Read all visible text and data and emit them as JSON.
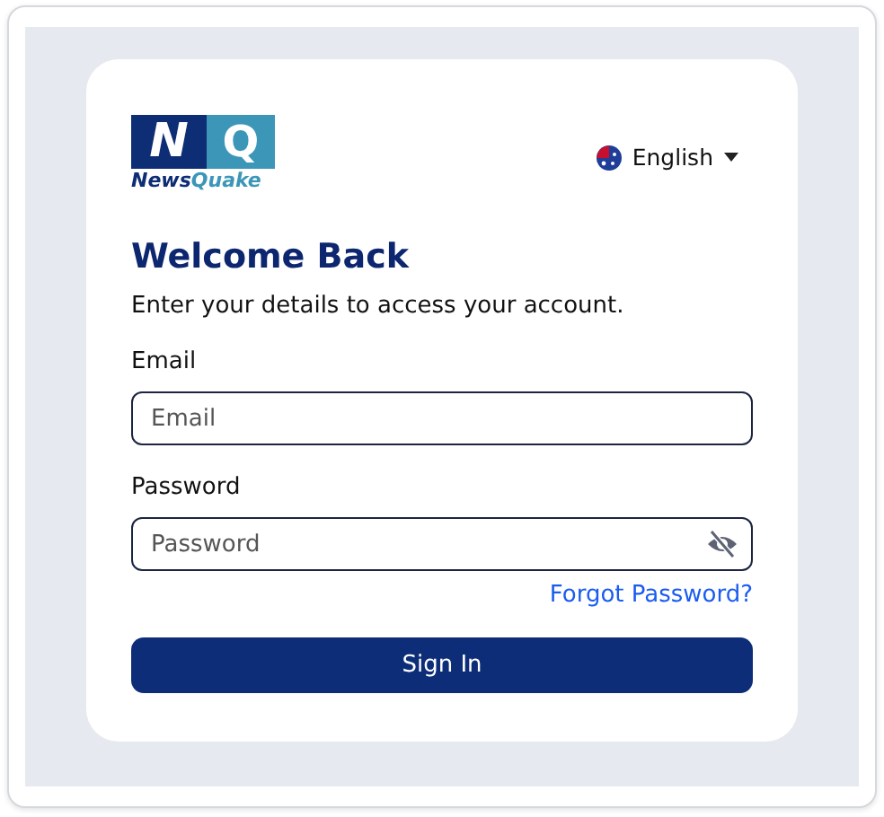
{
  "logo": {
    "mark_left": "N",
    "mark_right": "Q",
    "wordmark_first": "News",
    "wordmark_second": "Quake"
  },
  "language": {
    "label": "English"
  },
  "title": "Welcome Back",
  "subtitle": "Enter your details to access your account.",
  "fields": [
    {
      "label": "Email",
      "placeholder": "Email",
      "kind": "text"
    },
    {
      "label": "Password",
      "placeholder": "Password",
      "kind": "password"
    }
  ],
  "forgot_link": "Forgot Password?",
  "submit": "Sign In"
}
